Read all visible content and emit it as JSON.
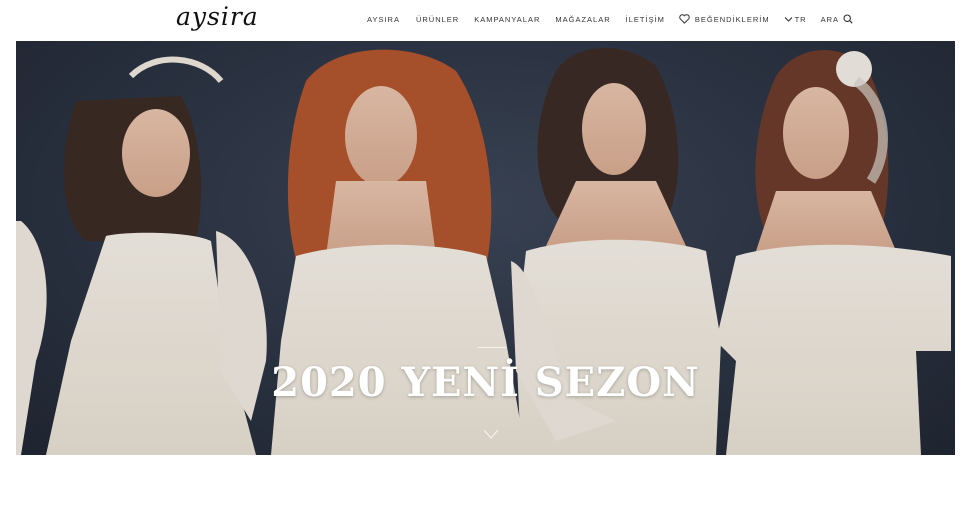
{
  "header": {
    "logo": "aysira",
    "nav": [
      {
        "label": "AYSIRA"
      },
      {
        "label": "ÜRÜNLER"
      },
      {
        "label": "KAMPANYALAR"
      },
      {
        "label": "MAĞAZALAR"
      },
      {
        "label": "İLETİŞİM"
      }
    ],
    "favorites_label": "BEĞENDİKLERİM",
    "language_label": "TR",
    "search_label": "ARA"
  },
  "hero": {
    "title": "2020 YENİ SEZON"
  },
  "icons": {
    "favorites": "heart-icon",
    "language": "chevron-down-icon",
    "search": "search-icon",
    "scroll": "chevron-down-icon"
  },
  "colors": {
    "hero_background": "#2b3342",
    "text": "#333333",
    "hero_text": "#ffffff"
  }
}
